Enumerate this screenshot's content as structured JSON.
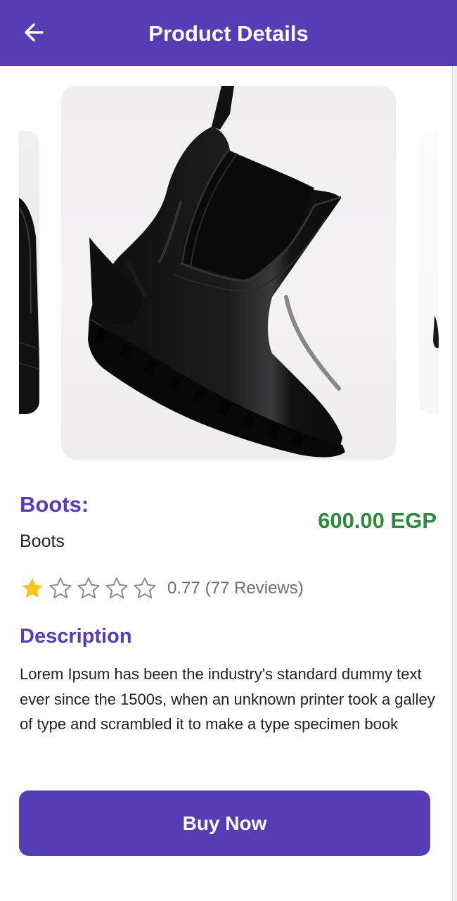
{
  "app_bar": {
    "title": "Product Details",
    "back_icon": "arrow-left-icon",
    "background_color": "#563cb5"
  },
  "carousel": {
    "images": [
      {
        "description": "black rubber chelsea boot, partial left"
      },
      {
        "description": "black glossy chelsea boot hanging by pull tab"
      },
      {
        "description": "black boot, partial right"
      }
    ]
  },
  "product": {
    "name_heading": "Boots:",
    "name_value": "Boots",
    "price": "600.00 EGP",
    "price_color": "#2e8b3a",
    "rating": {
      "stars_filled": 1,
      "stars_total": 5,
      "value": "0.77",
      "reviews_label": "(77 Reviews)",
      "star_color": "#f5c518"
    }
  },
  "description": {
    "heading": "Description",
    "text": "Lorem Ipsum has been the industry's standard dummy text ever since the 1500s, when an unknown printer took a galley of type and scrambled it to make a type specimen book"
  },
  "actions": {
    "buy_label": "Buy Now"
  },
  "colors": {
    "accent": "#563cb5",
    "heading": "#563cb5"
  }
}
